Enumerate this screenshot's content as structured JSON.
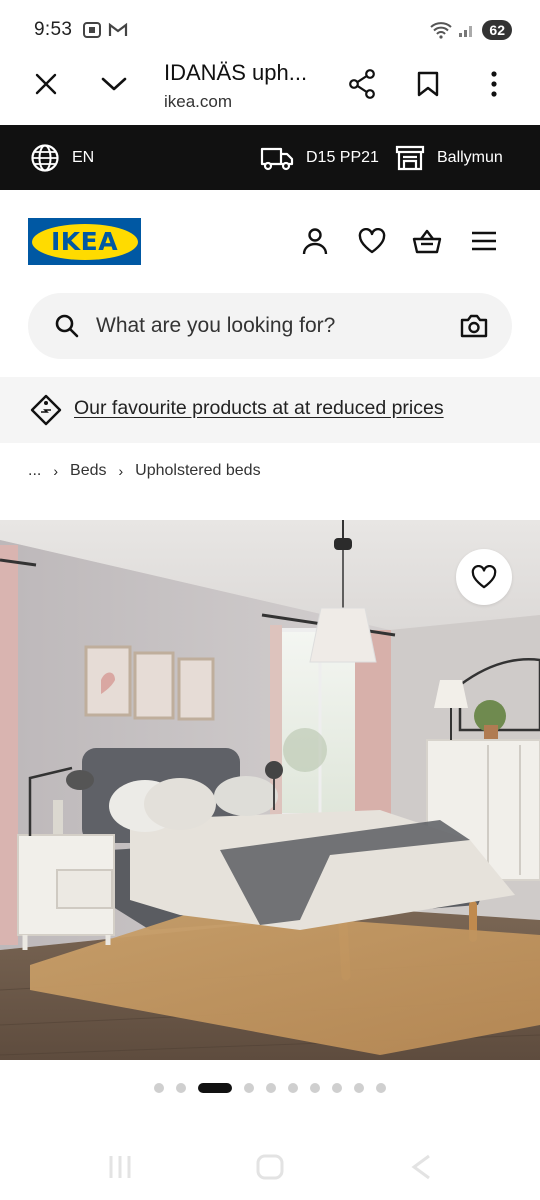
{
  "status_bar": {
    "time": "9:53",
    "battery": "62"
  },
  "browser": {
    "title": "IDANÄS uph...",
    "url": "ikea.com"
  },
  "locale_bar": {
    "language": "EN",
    "postcode": "D15 PP21",
    "store": "Ballymun"
  },
  "header": {
    "logo_text": "IKEA"
  },
  "search": {
    "placeholder": "What are you looking for?"
  },
  "promo": {
    "link_text": "Our favourite products at at reduced prices"
  },
  "breadcrumb": {
    "items": [
      "...",
      "Beds",
      "Upholstered beds"
    ]
  },
  "carousel": {
    "total_slides": 10,
    "active_index": 2
  },
  "colors": {
    "ikea_blue": "#0058a3",
    "ikea_yellow": "#ffdb00",
    "locale_bar_bg": "#111111"
  }
}
